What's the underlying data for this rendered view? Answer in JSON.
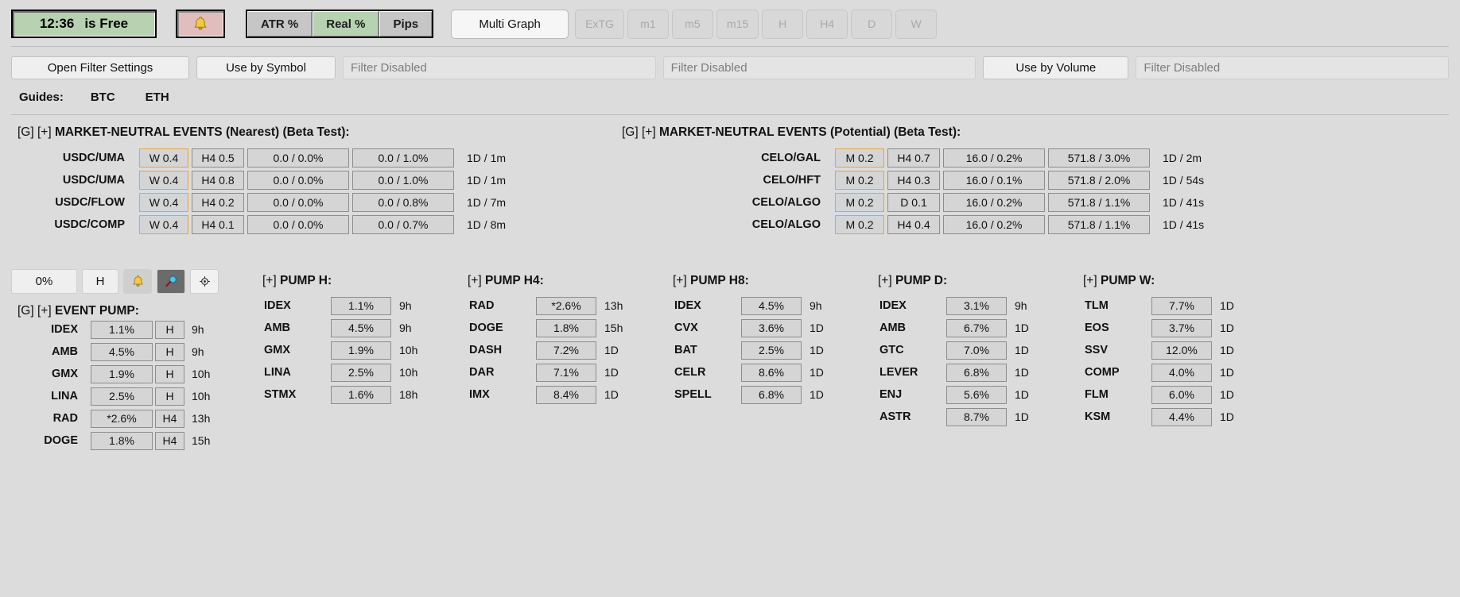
{
  "toolbar": {
    "clock_time": "12:36",
    "clock_status": "is Free",
    "bell_icon": "bell-icon",
    "segments": [
      {
        "label": "ATR %",
        "active": false
      },
      {
        "label": "Real %",
        "active": true
      },
      {
        "label": "Pips",
        "active": false
      }
    ],
    "multi_graph": "Multi Graph",
    "timeframes": [
      "ExTG",
      "m1",
      "m5",
      "m15",
      "H",
      "H4",
      "D",
      "W"
    ]
  },
  "filters": {
    "open_settings": "Open Filter Settings",
    "use_by_symbol": "Use by Symbol",
    "symbol_filter_status": "Filter Disabled",
    "second_filter_status": "Filter Disabled",
    "use_by_volume": "Use by Volume",
    "volume_filter_status": "Filter Disabled"
  },
  "guides": {
    "label": "Guides:",
    "items": [
      "BTC",
      "ETH"
    ]
  },
  "market_neutral_nearest": {
    "prefix": "[G] [+] ",
    "title": "MARKET-NEUTRAL EVENTS (Nearest) (Beta Test):",
    "rows": [
      {
        "pair": "USDC/UMA",
        "tf1": "W 0.4",
        "tf2": "H4 0.5",
        "col3": "0.0 / 0.0%",
        "col4": "0.0 / 1.0%",
        "tail": "1D / 1m"
      },
      {
        "pair": "USDC/UMA",
        "tf1": "W 0.4",
        "tf2": "H4 0.8",
        "col3": "0.0 / 0.0%",
        "col4": "0.0 / 1.0%",
        "tail": "1D / 1m"
      },
      {
        "pair": "USDC/FLOW",
        "tf1": "W 0.4",
        "tf2": "H4 0.2",
        "col3": "0.0 / 0.0%",
        "col4": "0.0 / 0.8%",
        "tail": "1D / 7m"
      },
      {
        "pair": "USDC/COMP",
        "tf1": "W 0.4",
        "tf2": "H4 0.1",
        "col3": "0.0 / 0.0%",
        "col4": "0.0 / 0.7%",
        "tail": "1D / 8m"
      }
    ]
  },
  "market_neutral_potential": {
    "prefix": "[G] [+] ",
    "title": "MARKET-NEUTRAL EVENTS (Potential) (Beta Test):",
    "rows": [
      {
        "pair": "CELO/GAL",
        "tf1": "M 0.2",
        "tf2": "H4 0.7",
        "col3": "16.0 / 0.2%",
        "col4": "571.8 / 3.0%",
        "tail": "1D / 2m"
      },
      {
        "pair": "CELO/HFT",
        "tf1": "M 0.2",
        "tf2": "H4 0.3",
        "col3": "16.0 / 0.1%",
        "col4": "571.8 / 2.0%",
        "tail": "1D / 54s"
      },
      {
        "pair": "CELO/ALGO",
        "tf1": "M 0.2",
        "tf2": "D 0.1",
        "col3": "16.0 / 0.2%",
        "col4": "571.8 / 1.1%",
        "tail": "1D / 41s"
      },
      {
        "pair": "CELO/ALGO",
        "tf1": "M 0.2",
        "tf2": "H4 0.4",
        "col3": "16.0 / 0.2%",
        "col4": "571.8 / 1.1%",
        "tail": "1D / 41s"
      }
    ]
  },
  "controls": {
    "percent": "0%",
    "timeframe": "H",
    "icons": [
      {
        "name": "bell-icon",
        "selected": false
      },
      {
        "name": "magnifier-icon",
        "selected": true
      },
      {
        "name": "gear-icon",
        "selected": false
      }
    ]
  },
  "event_pump": {
    "prefix": "[G] [+] ",
    "title": "EVENT PUMP:",
    "rows": [
      {
        "symbol": "IDEX",
        "value": "1.1%",
        "tf": "H",
        "age": "9h"
      },
      {
        "symbol": "AMB",
        "value": "4.5%",
        "tf": "H",
        "age": "9h"
      },
      {
        "symbol": "GMX",
        "value": "1.9%",
        "tf": "H",
        "age": "10h"
      },
      {
        "symbol": "LINA",
        "value": "2.5%",
        "tf": "H",
        "age": "10h"
      },
      {
        "symbol": "RAD",
        "value": "*2.6%",
        "tf": "H4",
        "age": "13h"
      },
      {
        "symbol": "DOGE",
        "value": "1.8%",
        "tf": "H4",
        "age": "15h"
      }
    ]
  },
  "pump_columns": [
    {
      "prefix": "[+] ",
      "title": "PUMP H:",
      "rows": [
        {
          "symbol": "IDEX",
          "value": "1.1%",
          "age": "9h"
        },
        {
          "symbol": "AMB",
          "value": "4.5%",
          "age": "9h"
        },
        {
          "symbol": "GMX",
          "value": "1.9%",
          "age": "10h"
        },
        {
          "symbol": "LINA",
          "value": "2.5%",
          "age": "10h"
        },
        {
          "symbol": "STMX",
          "value": "1.6%",
          "age": "18h"
        }
      ]
    },
    {
      "prefix": "[+] ",
      "title": "PUMP H4:",
      "rows": [
        {
          "symbol": "RAD",
          "value": "*2.6%",
          "age": "13h"
        },
        {
          "symbol": "DOGE",
          "value": "1.8%",
          "age": "15h"
        },
        {
          "symbol": "DASH",
          "value": "7.2%",
          "age": "1D"
        },
        {
          "symbol": "DAR",
          "value": "7.1%",
          "age": "1D"
        },
        {
          "symbol": "IMX",
          "value": "8.4%",
          "age": "1D"
        }
      ]
    },
    {
      "prefix": "[+] ",
      "title": "PUMP H8:",
      "rows": [
        {
          "symbol": "IDEX",
          "value": "4.5%",
          "age": "9h"
        },
        {
          "symbol": "CVX",
          "value": "3.6%",
          "age": "1D"
        },
        {
          "symbol": "BAT",
          "value": "2.5%",
          "age": "1D"
        },
        {
          "symbol": "CELR",
          "value": "8.6%",
          "age": "1D"
        },
        {
          "symbol": "SPELL",
          "value": "6.8%",
          "age": "1D"
        }
      ]
    },
    {
      "prefix": "[+] ",
      "title": "PUMP D:",
      "rows": [
        {
          "symbol": "IDEX",
          "value": "3.1%",
          "age": "9h"
        },
        {
          "symbol": "AMB",
          "value": "6.7%",
          "age": "1D"
        },
        {
          "symbol": "GTC",
          "value": "7.0%",
          "age": "1D"
        },
        {
          "symbol": "LEVER",
          "value": "6.8%",
          "age": "1D"
        },
        {
          "symbol": "ENJ",
          "value": "5.6%",
          "age": "1D"
        },
        {
          "symbol": "ASTR",
          "value": "8.7%",
          "age": "1D"
        }
      ]
    },
    {
      "prefix": "[+] ",
      "title": "PUMP W:",
      "rows": [
        {
          "symbol": "TLM",
          "value": "7.7%",
          "age": "1D"
        },
        {
          "symbol": "EOS",
          "value": "3.7%",
          "age": "1D"
        },
        {
          "symbol": "SSV",
          "value": "12.0%",
          "age": "1D"
        },
        {
          "symbol": "COMP",
          "value": "4.0%",
          "age": "1D"
        },
        {
          "symbol": "FLM",
          "value": "6.0%",
          "age": "1D"
        },
        {
          "symbol": "KSM",
          "value": "4.4%",
          "age": "1D"
        }
      ]
    }
  ],
  "colors": {
    "background": "#dcdcdc",
    "clock_green": "#b7d2b1",
    "bell_pink": "#e2bdbd",
    "accent_orange": "#e8a33d",
    "cell_gray": "#d5d5d5",
    "disabled_text": "#a9a9a9"
  }
}
